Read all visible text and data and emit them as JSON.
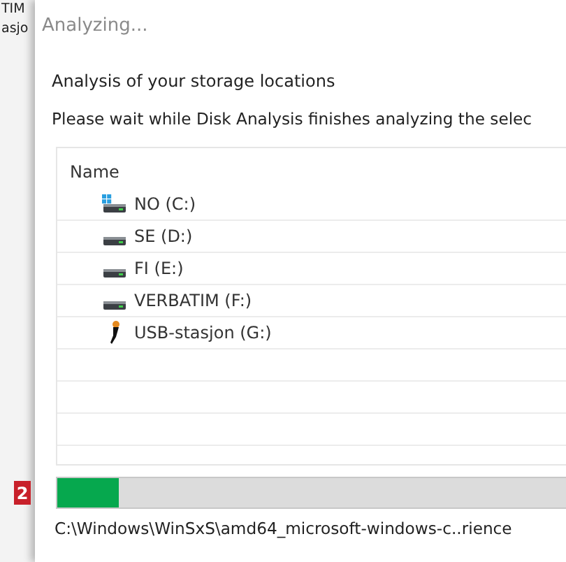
{
  "background_window": {
    "lines": [
      "TIM",
      "asjo"
    ]
  },
  "dialog": {
    "title": "Analyzing...",
    "heading": "Analysis of your storage locations",
    "message": "Please wait while Disk Analysis finishes analyzing the selec",
    "list": {
      "column": "Name",
      "rows": [
        {
          "label": "NO (C:)",
          "kind": "system"
        },
        {
          "label": "SE (D:)",
          "kind": "drive"
        },
        {
          "label": "FI (E:)",
          "kind": "drive"
        },
        {
          "label": "VERBATIM (F:)",
          "kind": "drive"
        },
        {
          "label": "USB-stasjon (G:)",
          "kind": "usb"
        }
      ]
    },
    "callout": "2",
    "progress": {
      "level": 0.12
    },
    "current_path": "C:\\Windows\\WinSxS\\amd64_microsoft-windows-c..rience"
  }
}
